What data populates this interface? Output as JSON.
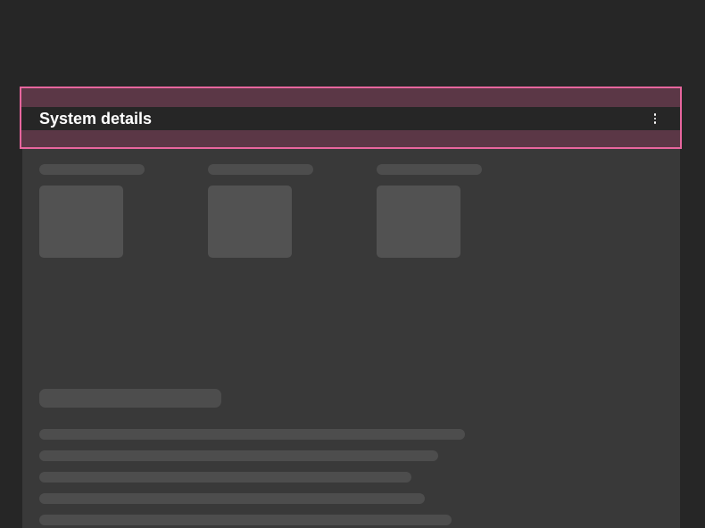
{
  "panel": {
    "title": "System details",
    "overflow_menu_icon": "overflow-menu-vertical-icon"
  },
  "colors": {
    "page_background": "#262626",
    "card_background": "#393939",
    "highlight_border": "#e8669e",
    "highlight_fill": "#5b3746",
    "skeleton": "#4d4d4d",
    "title_text": "#ffffff"
  }
}
